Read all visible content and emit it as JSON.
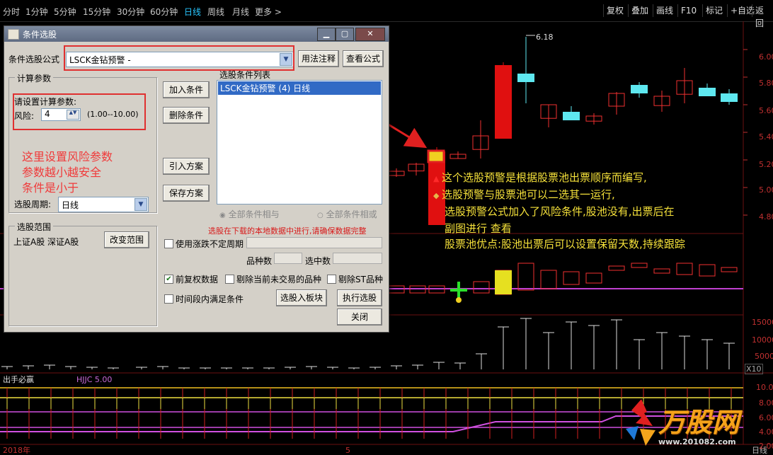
{
  "toolbar": {
    "periods": [
      "分时",
      "1分钟",
      "5分钟",
      "15分钟",
      "30分钟",
      "60分钟",
      "日线",
      "周线",
      "月线",
      "更多 >"
    ],
    "active_period": "日线",
    "right_buttons": [
      "复权",
      "叠加",
      "画线",
      "F10",
      "标记",
      "+自选",
      "返回"
    ]
  },
  "chart_header": {
    "indicator_name": "出手必赢",
    "indicator_value": "HJJC 5.00",
    "max_label": "6.18"
  },
  "price_axis": [
    "6.00",
    "5.80",
    "5.60",
    "5.40",
    "5.20",
    "5.00",
    "4.80"
  ],
  "volume_axis": [
    "15000",
    "10000",
    "5000",
    "X10"
  ],
  "indicator_axis": [
    "10.00",
    "8.00",
    "6.00",
    "4.00",
    "2.00"
  ],
  "bottom_axis": {
    "left": "2018年",
    "mid": "5",
    "right": "日线"
  },
  "dialog": {
    "title": "条件选股",
    "formula_label": "条件选股公式",
    "formula_value": "LSCK金钻预警 -",
    "btn_usage": "用法注释",
    "btn_view": "查看公式",
    "params_group": "计算参数",
    "params_prompt": "请设置计算参数:",
    "risk_label": "风险:",
    "risk_value": "4",
    "risk_range": "(1.00--10.00)",
    "period_label": "选股周期:",
    "period_value": "日线",
    "range_group": "选股范围",
    "range_value": "上证A股 深证A股",
    "btn_change_range": "改变范围",
    "btn_add": "加入条件",
    "btn_delete": "删除条件",
    "btn_import": "引入方案",
    "btn_save": "保存方案",
    "list_title": "选股条件列表",
    "list_items": [
      "LSCK金钻预警 (4) 日线"
    ],
    "radio_and": "全部条件相与",
    "radio_or": "全部条件相或",
    "warning": "选股在下载的本地数据中进行,请确保数据完整",
    "chk_variable_period": "使用涨跌不定周期",
    "count_label": "品种数",
    "selected_label": "选中数",
    "chk_fq": "前复权数据",
    "chk_exclude_untraded": "剔除当前未交易的品种",
    "chk_exclude_st": "剔除ST品种",
    "chk_time_range": "时间段内满足条件",
    "btn_to_block": "选股入板块",
    "btn_execute": "执行选股",
    "btn_close": "关闭"
  },
  "annotation_left": [
    "这里设置风险参数",
    "参数越小越安全",
    "条件是小于"
  ],
  "annotation_right": [
    "这个选股预警是根据股票池出票顺序而编写,",
    "选股预警与股票池可以二选其一运行,",
    "选股预警公式加入了风险条件,股池没有,出票后在",
    "副图进行 查看",
    "股票池优点:股池出票后可以设置保留天数,持续跟踪"
  ],
  "watermark": {
    "brand": "万股网",
    "url": "www.201082.com"
  }
}
